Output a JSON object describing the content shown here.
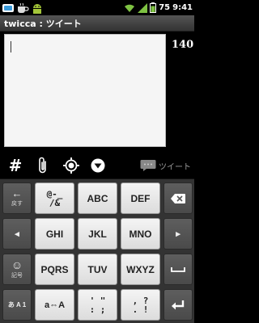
{
  "status_bar": {
    "notifications": [
      "app-notification-icon",
      "coffee-icon",
      "android-icon"
    ],
    "battery_percent": "75",
    "time": "9:41"
  },
  "title": "twicca : ツイート",
  "compose": {
    "text": "",
    "remaining": "140"
  },
  "toolbar": {
    "hashtag_label": "#",
    "tweet_label": "ツイート"
  },
  "keyboard": {
    "rows": [
      [
        {
          "label": "←",
          "sub": "戻す",
          "type": "func",
          "name": "undo-key"
        },
        {
          "label": "@-_\n/&",
          "type": "light",
          "name": "key-symbols-1"
        },
        {
          "label": "ABC",
          "type": "light",
          "name": "key-abc"
        },
        {
          "label": "DEF",
          "type": "light",
          "name": "key-def"
        },
        {
          "label": "⌫",
          "type": "func",
          "name": "backspace-key"
        }
      ],
      [
        {
          "label": "◂",
          "type": "func",
          "name": "cursor-left-key"
        },
        {
          "label": "GHI",
          "type": "light",
          "name": "key-ghi"
        },
        {
          "label": "JKL",
          "type": "light",
          "name": "key-jkl"
        },
        {
          "label": "MNO",
          "type": "light",
          "name": "key-mno"
        },
        {
          "label": "▸",
          "type": "func",
          "name": "cursor-right-key"
        }
      ],
      [
        {
          "label": "☺",
          "sub": "記号",
          "type": "func",
          "name": "emoji-symbol-key"
        },
        {
          "label": "PQRS",
          "type": "light",
          "name": "key-pqrs"
        },
        {
          "label": "TUV",
          "type": "light",
          "name": "key-tuv"
        },
        {
          "label": "WXYZ",
          "type": "light",
          "name": "key-wxyz"
        },
        {
          "label": "␣",
          "type": "func",
          "name": "space-key"
        }
      ],
      [
        {
          "label": "あ A 1",
          "type": "func",
          "name": "input-mode-key"
        },
        {
          "label": "a⇔A",
          "type": "light",
          "name": "case-toggle-key"
        },
        {
          "label": "' \"\n: ;",
          "type": "light",
          "name": "key-quotes"
        },
        {
          "label": ", ?\n. !",
          "type": "light",
          "name": "key-punctuation"
        },
        {
          "label": "↵",
          "type": "func",
          "name": "enter-key"
        }
      ]
    ]
  },
  "colors": {
    "status_bg": "#000000",
    "title_bg": "#444444",
    "keyboard_bg": "#333333",
    "key_light": "#e8e8e8",
    "key_func": "#555555",
    "signal_green": "#7ec242"
  }
}
